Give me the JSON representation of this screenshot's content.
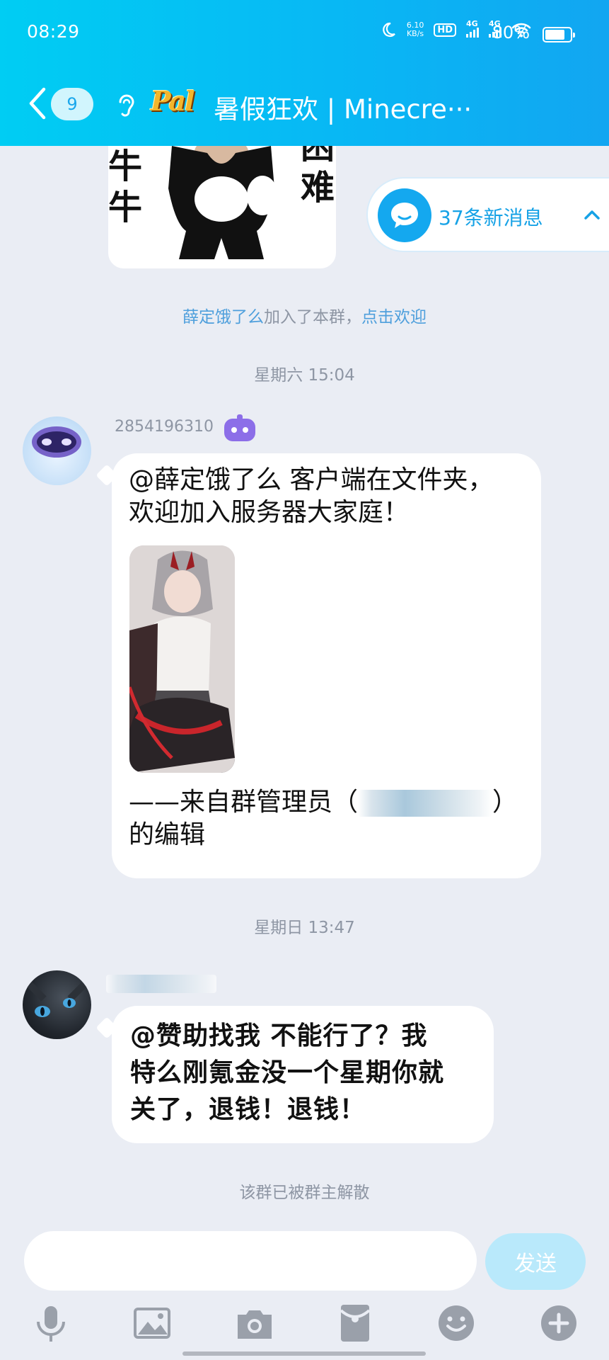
{
  "status_bar": {
    "time": "08:29",
    "net_speed_value": "6.10",
    "net_speed_unit": "KB/s",
    "hd_label": "HD",
    "signal_1_label": "4G",
    "signal_2_label": "4G",
    "battery_percent_text": "80%",
    "battery_level": 0.8
  },
  "header": {
    "unread_count": "9",
    "logo_text": "Pal",
    "title": "暑假狂欢 | Minecre···"
  },
  "sticker": {
    "left_text": "牛牛",
    "right_text": "困难"
  },
  "new_messages": {
    "label": "37条新消息"
  },
  "join_notice": {
    "name": "薛定饿了么",
    "middle": "加入了本群，",
    "action": "点击欢迎"
  },
  "timestamps": {
    "first": "星期六 15:04",
    "second": "星期日 13:47"
  },
  "message_1": {
    "sender": "2854196310",
    "line_1": "@薛定饿了么 客户端在文件夹，",
    "line_2": "欢迎加入服务器大家庭！",
    "footer_prefix": "——来自群管理员（",
    "footer_suffix": "）",
    "footer_line_2": "的编辑"
  },
  "message_2": {
    "line_1": "@赞助找我 不能行了？我",
    "line_2": "特么刚氪金没一个星期你就",
    "line_3": "关了，退钱！退钱！"
  },
  "dissolved_notice": "该群已被群主解散",
  "composer": {
    "send_label": "发送"
  },
  "colors": {
    "header_start": "#00cdf3",
    "header_end": "#12a6f1",
    "accent": "#16a2e6",
    "chat_background": "#eaedf4",
    "send_disabled": "#b9e9fb"
  },
  "icons": [
    "back-chevron-icon",
    "ear-icon",
    "bot-icon",
    "chat-bubble-icon",
    "chevron-up-icon",
    "microphone-icon",
    "image-icon",
    "camera-icon",
    "red-packet-icon",
    "emoji-icon",
    "plus-icon"
  ]
}
